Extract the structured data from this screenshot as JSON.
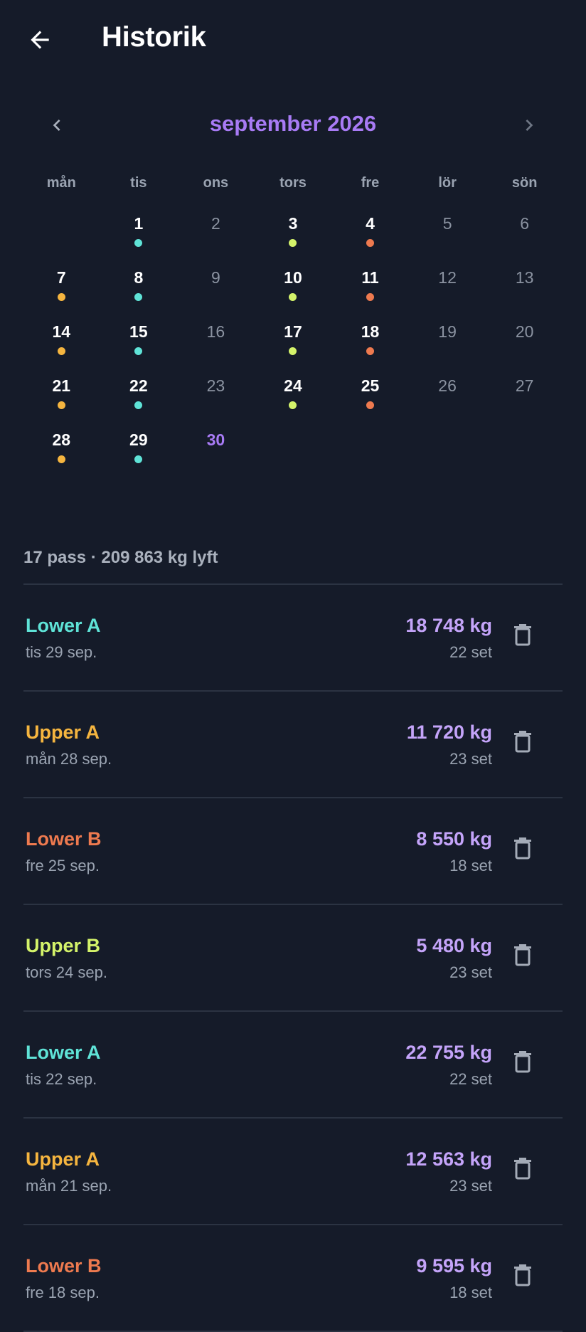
{
  "appbar": {
    "title": "Historik"
  },
  "calendar": {
    "month_title": "september 2026",
    "weekdays": [
      "mån",
      "tis",
      "ons",
      "tors",
      "fre",
      "lör",
      "sön"
    ],
    "leading_blank_days": 1,
    "days": [
      {
        "n": "1",
        "dot": "cyan"
      },
      {
        "n": "2"
      },
      {
        "n": "3",
        "dot": "lime"
      },
      {
        "n": "4",
        "dot": "orange"
      },
      {
        "n": "5"
      },
      {
        "n": "6"
      },
      {
        "n": "7",
        "dot": "amber"
      },
      {
        "n": "8",
        "dot": "cyan"
      },
      {
        "n": "9"
      },
      {
        "n": "10",
        "dot": "lime"
      },
      {
        "n": "11",
        "dot": "orange"
      },
      {
        "n": "12"
      },
      {
        "n": "13"
      },
      {
        "n": "14",
        "dot": "amber"
      },
      {
        "n": "15",
        "dot": "cyan"
      },
      {
        "n": "16"
      },
      {
        "n": "17",
        "dot": "lime"
      },
      {
        "n": "18",
        "dot": "orange"
      },
      {
        "n": "19"
      },
      {
        "n": "20"
      },
      {
        "n": "21",
        "dot": "amber"
      },
      {
        "n": "22",
        "dot": "cyan"
      },
      {
        "n": "23"
      },
      {
        "n": "24",
        "dot": "lime"
      },
      {
        "n": "25",
        "dot": "orange"
      },
      {
        "n": "26"
      },
      {
        "n": "27"
      },
      {
        "n": "28",
        "dot": "amber"
      },
      {
        "n": "29",
        "dot": "cyan"
      },
      {
        "n": "30",
        "today": true
      }
    ]
  },
  "colors": {
    "cyan": "#5fe3d7",
    "amber": "#f5b53f",
    "orange": "#ee7a4f",
    "lime": "#d4f36a",
    "accent": "#a87bf5",
    "kg": "#c4a4f9"
  },
  "summary": "17 pass · 209 863 kg lyft",
  "workouts": [
    {
      "name": "Lower A",
      "color": "cyan",
      "date": "tis 29 sep.",
      "kg": "18 748 kg",
      "sets": "22 set"
    },
    {
      "name": "Upper A",
      "color": "amber",
      "date": "mån 28 sep.",
      "kg": "11 720 kg",
      "sets": "23 set"
    },
    {
      "name": "Lower B",
      "color": "orange",
      "date": "fre 25 sep.",
      "kg": "8 550 kg",
      "sets": "18 set"
    },
    {
      "name": "Upper B",
      "color": "lime",
      "date": "tors 24 sep.",
      "kg": "5 480 kg",
      "sets": "23 set"
    },
    {
      "name": "Lower A",
      "color": "cyan",
      "date": "tis 22 sep.",
      "kg": "22 755 kg",
      "sets": "22 set"
    },
    {
      "name": "Upper A",
      "color": "amber",
      "date": "mån 21 sep.",
      "kg": "12 563 kg",
      "sets": "23 set"
    },
    {
      "name": "Lower B",
      "color": "orange",
      "date": "fre 18 sep.",
      "kg": "9 595 kg",
      "sets": "18 set"
    }
  ]
}
